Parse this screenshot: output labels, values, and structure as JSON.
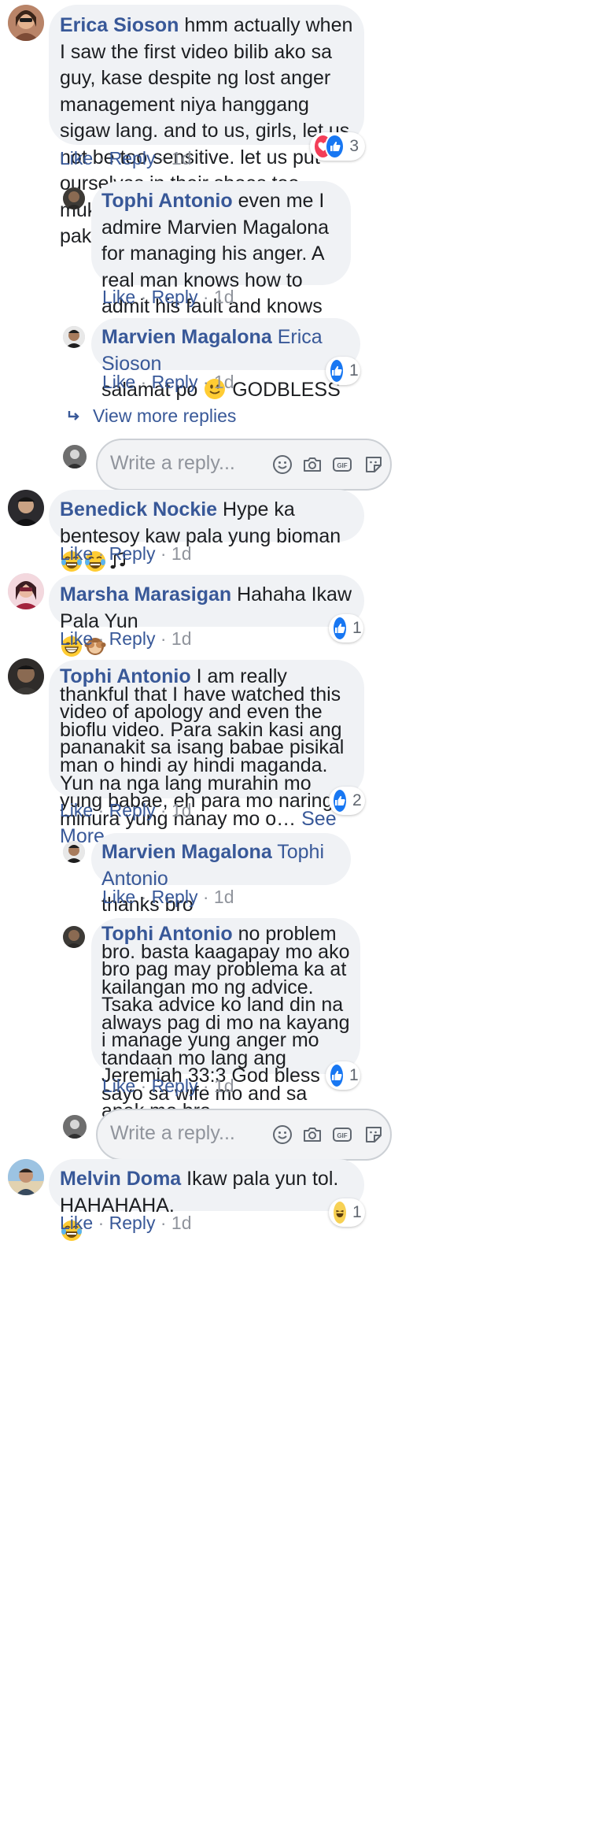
{
  "comments": {
    "c1": {
      "author": "Erica Sioson",
      "text": "hmm actually when I saw the first video bilib ako sa guy, kase despite ng lost anger management niya hanggang sigaw lang. and to us, girls, let us not be too sensitive. let us put ourselves in their shoes too. mukhang masama naman ang pakiramdam niya",
      "like": "Like",
      "reply": "Reply",
      "time": "1d",
      "reaction_count": "3"
    },
    "r1": {
      "author": "Tophi Antonio",
      "text": "even me I admire Marvien Magalona for managing his anger. A real man knows how to admit his fault and knows how to respect a woman.",
      "like": "Like",
      "reply": "Reply",
      "time": "1d"
    },
    "r2": {
      "author": "Marvien Magalona",
      "mention": "Erica Sioson",
      "text_a": "salamat po",
      "text_b": "GODBLESS",
      "like": "Like",
      "reply": "Reply",
      "time": "1d",
      "reaction_count": "1"
    },
    "c2": {
      "author": "Benedick Nockie",
      "text": "Hype ka bentesoy kaw pala yung bioman",
      "like": "Like",
      "reply": "Reply",
      "time": "1d"
    },
    "c3": {
      "author": "Marsha Marasigan",
      "text": "Hahaha Ikaw Pala Yun",
      "like": "Like",
      "reply": "Reply",
      "time": "1d",
      "reaction_count": "1"
    },
    "c4": {
      "author": "Tophi Antonio",
      "text": "I am really thankful that I have watched this video of apology and even the bioflu video. Para sakin kasi ang pananakit sa isang babae pisikal man o hindi ay hindi maganda. Yun na nga lang murahin mo yung babae, eh para mo naring minura yung nanay mo o…",
      "see_more": "See More",
      "like": "Like",
      "reply": "Reply",
      "time": "1d",
      "reaction_count": "2"
    },
    "r3": {
      "author": "Marvien Magalona",
      "mention": "Tophi Antonio",
      "text": "thanks bro",
      "like": "Like",
      "reply": "Reply",
      "time": "1d"
    },
    "r4": {
      "author": "Tophi Antonio",
      "text": "no problem bro. basta kaagapay mo ako bro pag may problema ka at kailangan mo ng advice. Tsaka advice ko land din na always pag di mo na kayang i manage yung anger mo tandaan mo lang ang Jeremiah 33:3 God bless sayo sa wife mo and sa anak mo bro.",
      "like": "Like",
      "reply": "Reply",
      "time": "1d",
      "reaction_count": "1"
    },
    "c5": {
      "author": "Melvin Doma",
      "text": "Ikaw pala yun tol. HAHAHAHA.",
      "like": "Like",
      "reply": "Reply",
      "time": "1d",
      "reaction_count": "1"
    }
  },
  "view_more_replies": "View more replies",
  "reply_box": {
    "placeholder": "Write a reply..."
  },
  "icons": [
    "emoji-icon",
    "camera-icon",
    "gif-icon",
    "sticker-icon",
    "like-reaction-icon",
    "love-reaction-icon",
    "haha-reaction-icon",
    "reply-arrow-icon"
  ],
  "colors": {
    "link": "#385898",
    "bubble": "#f0f2f5",
    "like": "#1877f2",
    "love": "#f33e58",
    "meta": "#90949c"
  }
}
